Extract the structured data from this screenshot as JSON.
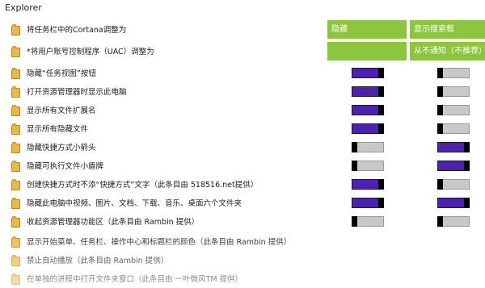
{
  "window": {
    "title": "Explorer"
  },
  "headers": {
    "row1": {
      "left": "隐藏",
      "right": "显示搜索框"
    },
    "row2": {
      "left": "",
      "right": "从不通知（不推荐）"
    }
  },
  "items": [
    {
      "label": "将任务栏中的Cortana调整为",
      "toggle_left": null,
      "toggle_right": null
    },
    {
      "label": "*将用户账号控制程序（UAC）调整为",
      "toggle_left": null,
      "toggle_right": null
    },
    {
      "label": "隐藏“任务视图”按钮",
      "toggle_left": "on",
      "toggle_right": "off"
    },
    {
      "label": "打开资源管理器时显示此电脑",
      "toggle_left": "on",
      "toggle_right": "off"
    },
    {
      "label": "显示所有文件扩展名",
      "toggle_left": "on",
      "toggle_right": "off"
    },
    {
      "label": "显示所有隐藏文件",
      "toggle_left": "on",
      "toggle_right": "off"
    },
    {
      "label": "隐藏快捷方式小箭头",
      "toggle_left": "off",
      "toggle_right": "on"
    },
    {
      "label": "隐藏可执行文件小盾牌",
      "toggle_left": "off",
      "toggle_right": "on"
    },
    {
      "label": "创建快捷方式时不添“快捷方式”文字（此条目由 518516.net提供）",
      "toggle_left": "on",
      "toggle_right": "off"
    },
    {
      "label": "隐藏此电脑中视频、图片、文档、下载、音乐、桌面六个文件夹",
      "toggle_left": "on",
      "toggle_right": "on"
    },
    {
      "label": "收起资源管理器功能区（此条目由 Rambin 提供）",
      "toggle_left": "off",
      "toggle_right": "off"
    },
    {
      "label": "显示开始菜单、任务栏、操作中心和标题栏的颜色（此条目由 Rambin 提供）",
      "toggle_left": null,
      "toggle_right": null
    },
    {
      "label": "禁止自动播放（此条目由 Rambin 提供）",
      "toggle_left": null,
      "toggle_right": null
    },
    {
      "label": "在单独的进程中打开文件夹窗口（此条目由 一叶微风TM 提供）",
      "toggle_left": null,
      "toggle_right": null
    }
  ],
  "colors": {
    "accent_green": "#8cc63f",
    "toggle_on": "#4d22b0",
    "toggle_off": "#c8c8c8"
  }
}
